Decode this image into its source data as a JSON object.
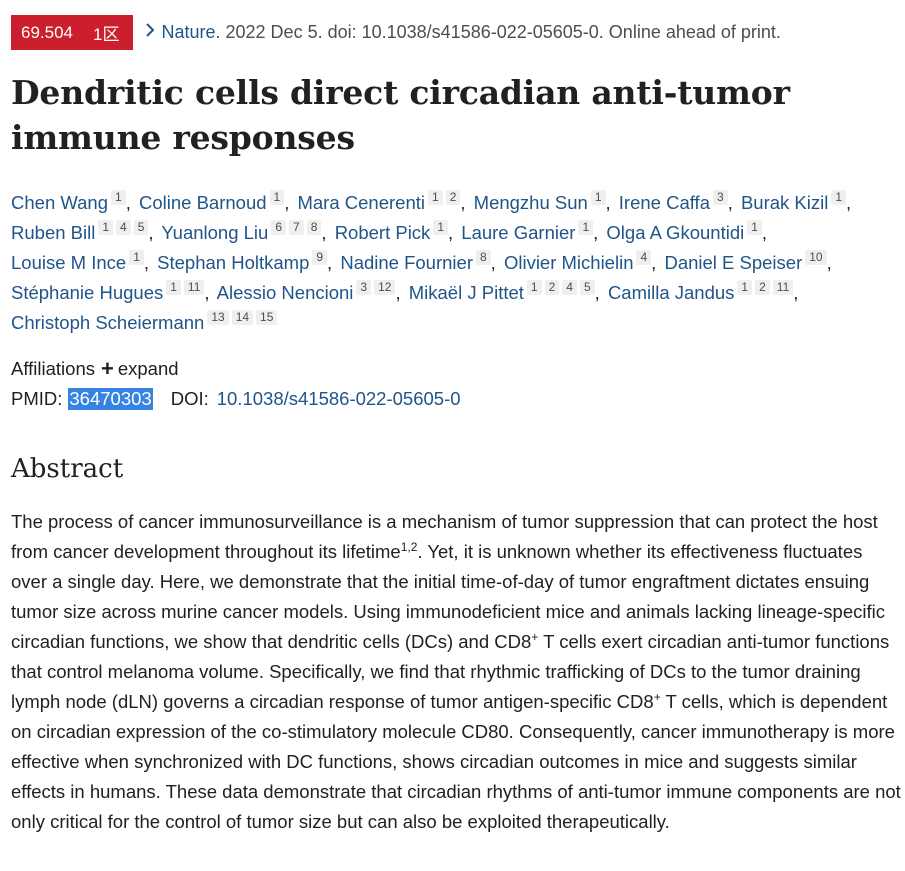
{
  "badge": {
    "impact_factor": "69.504",
    "zone": "1区"
  },
  "citation": {
    "journal": "Nature.",
    "details": "2022 Dec 5. doi: 10.1038/s41586-022-05605-0. Online ahead of print."
  },
  "title": "Dendritic cells direct circadian anti-tumor immune responses",
  "authors": [
    {
      "name": "Chen Wang",
      "affs": [
        "1"
      ]
    },
    {
      "name": "Coline Barnoud",
      "affs": [
        "1"
      ]
    },
    {
      "name": "Mara Cenerenti",
      "affs": [
        "1",
        "2"
      ]
    },
    {
      "name": "Mengzhu Sun",
      "affs": [
        "1"
      ]
    },
    {
      "name": "Irene Caffa",
      "affs": [
        "3"
      ]
    },
    {
      "name": "Burak Kizil",
      "affs": [
        "1"
      ]
    },
    {
      "name": "Ruben Bill",
      "affs": [
        "1",
        "4",
        "5"
      ]
    },
    {
      "name": "Yuanlong Liu",
      "affs": [
        "6",
        "7",
        "8"
      ]
    },
    {
      "name": "Robert Pick",
      "affs": [
        "1"
      ]
    },
    {
      "name": "Laure Garnier",
      "affs": [
        "1"
      ]
    },
    {
      "name": "Olga A Gkountidi",
      "affs": [
        "1"
      ]
    },
    {
      "name": "Louise M Ince",
      "affs": [
        "1"
      ]
    },
    {
      "name": "Stephan Holtkamp",
      "affs": [
        "9"
      ]
    },
    {
      "name": "Nadine Fournier",
      "affs": [
        "8"
      ]
    },
    {
      "name": "Olivier Michielin",
      "affs": [
        "4"
      ]
    },
    {
      "name": "Daniel E Speiser",
      "affs": [
        "10"
      ]
    },
    {
      "name": "Stéphanie Hugues",
      "affs": [
        "1",
        "11"
      ]
    },
    {
      "name": "Alessio Nencioni",
      "affs": [
        "3",
        "12"
      ]
    },
    {
      "name": "Mikaël J Pittet",
      "affs": [
        "1",
        "2",
        "4",
        "5"
      ]
    },
    {
      "name": "Camilla Jandus",
      "affs": [
        "1",
        "2",
        "11"
      ]
    },
    {
      "name": "Christoph Scheiermann",
      "affs": [
        "13",
        "14",
        "15"
      ]
    }
  ],
  "affiliations": {
    "label": "Affiliations",
    "expand_label": "expand"
  },
  "ids": {
    "pmid_label": "PMID:",
    "pmid": "36470303",
    "doi_label": "DOI:",
    "doi": "10.1038/s41586-022-05605-0"
  },
  "abstract": {
    "heading": "Abstract",
    "segments": [
      {
        "t": "The process of cancer immunosurveillance is a mechanism of tumor suppression that can protect the host from cancer development throughout its lifetime"
      },
      {
        "t": "1,2",
        "sup": true
      },
      {
        "t": ". Yet, it is unknown whether its effectiveness fluctuates over a single day. Here, we demonstrate that the initial time-of-day of tumor engraftment dictates ensuing tumor size across murine cancer models. Using immunodeficient mice and animals lacking lineage-specific circadian functions, we show that dendritic cells (DCs) and CD8"
      },
      {
        "t": "+",
        "sup": true
      },
      {
        "t": " T cells exert circadian anti-tumor functions that control melanoma volume. Specifically, we find that rhythmic trafficking of DCs to the tumor draining lymph node (dLN) governs a circadian response of tumor antigen-specific CD8"
      },
      {
        "t": "+",
        "sup": true
      },
      {
        "t": " T cells, which is dependent on circadian expression of the co-stimulatory molecule CD80. Consequently, cancer immunotherapy is more effective when synchronized with DC functions, shows circadian outcomes in mice and suggests similar effects in humans. These data demonstrate that circadian rhythms of anti-tumor immune components are not only critical for the control of tumor size but can also be exploited therapeutically."
      }
    ]
  },
  "colors": {
    "badge_bg": "#cc1f2d",
    "link": "#20558a",
    "selection": "#3584e4"
  }
}
